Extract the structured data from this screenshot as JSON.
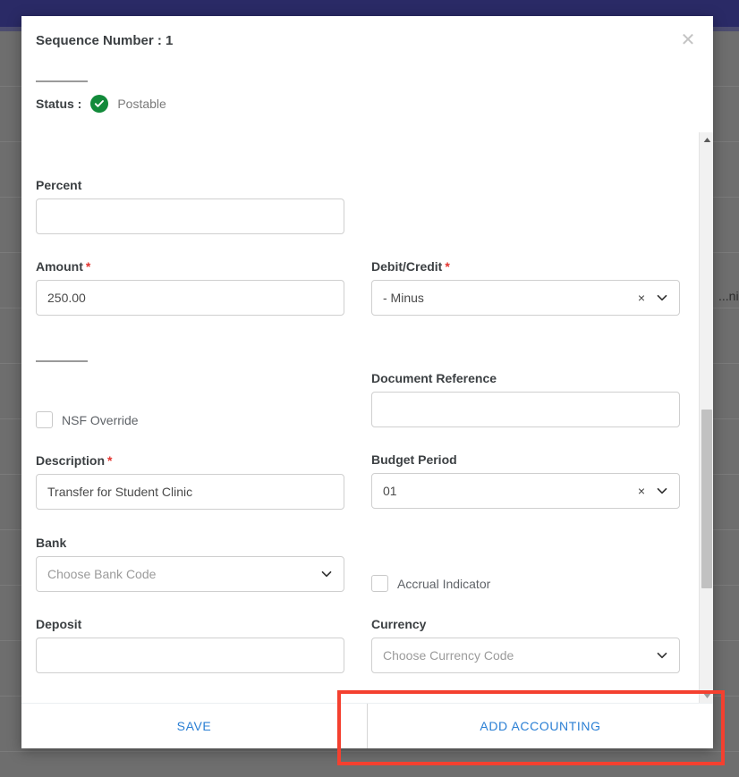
{
  "background": {
    "visible_text": "...nization",
    "topbar_color": "#2a2a66",
    "overlay_color": "#6e6e6e"
  },
  "modal": {
    "title": "Sequence Number : 1",
    "close_icon": "close-icon",
    "status": {
      "label": "Status :",
      "icon": "check-circle-icon",
      "icon_color": "#128a3a",
      "value": "Postable"
    },
    "fields": {
      "percent": {
        "label": "Percent",
        "required": false,
        "value": "",
        "placeholder": ""
      },
      "amount": {
        "label": "Amount",
        "required": true,
        "required_mark": "*",
        "value": "250.00",
        "placeholder": ""
      },
      "debit_credit": {
        "label": "Debit/Credit",
        "required": true,
        "required_mark": "*",
        "value": "- Minus",
        "is_placeholder": false,
        "clear_icon": "clear-icon",
        "clear_glyph": "×",
        "caret_icon": "chevron-down-icon"
      },
      "nsf_override": {
        "label": "NSF Override",
        "checked": false
      },
      "document_reference": {
        "label": "Document Reference",
        "required": false,
        "value": "",
        "placeholder": ""
      },
      "description": {
        "label": "Description",
        "required": true,
        "required_mark": "*",
        "value": "Transfer for Student Clinic",
        "placeholder": ""
      },
      "budget_period": {
        "label": "Budget Period",
        "required": false,
        "value": "01",
        "is_placeholder": false,
        "clear_icon": "clear-icon",
        "clear_glyph": "×",
        "caret_icon": "chevron-down-icon"
      },
      "bank": {
        "label": "Bank",
        "required": false,
        "value": "Choose Bank Code",
        "is_placeholder": true,
        "caret_icon": "chevron-down-icon"
      },
      "accrual_indicator": {
        "label": "Accrual Indicator",
        "checked": false
      },
      "deposit": {
        "label": "Deposit",
        "required": false,
        "value": "",
        "placeholder": ""
      },
      "currency": {
        "label": "Currency",
        "required": false,
        "value": "Choose Currency Code",
        "is_placeholder": true,
        "caret_icon": "chevron-down-icon"
      }
    },
    "footer": {
      "save_label": "SAVE",
      "add_accounting_label": "ADD ACCOUNTING",
      "link_color": "#2a7fd4"
    },
    "scrollbar": {
      "up_icon": "scroll-up-arrow-icon",
      "down_icon": "scroll-down-arrow-icon",
      "thumb_color": "#c1c1c1"
    }
  },
  "annotation": {
    "target": "add-accounting-button",
    "color": "#f4402f"
  }
}
